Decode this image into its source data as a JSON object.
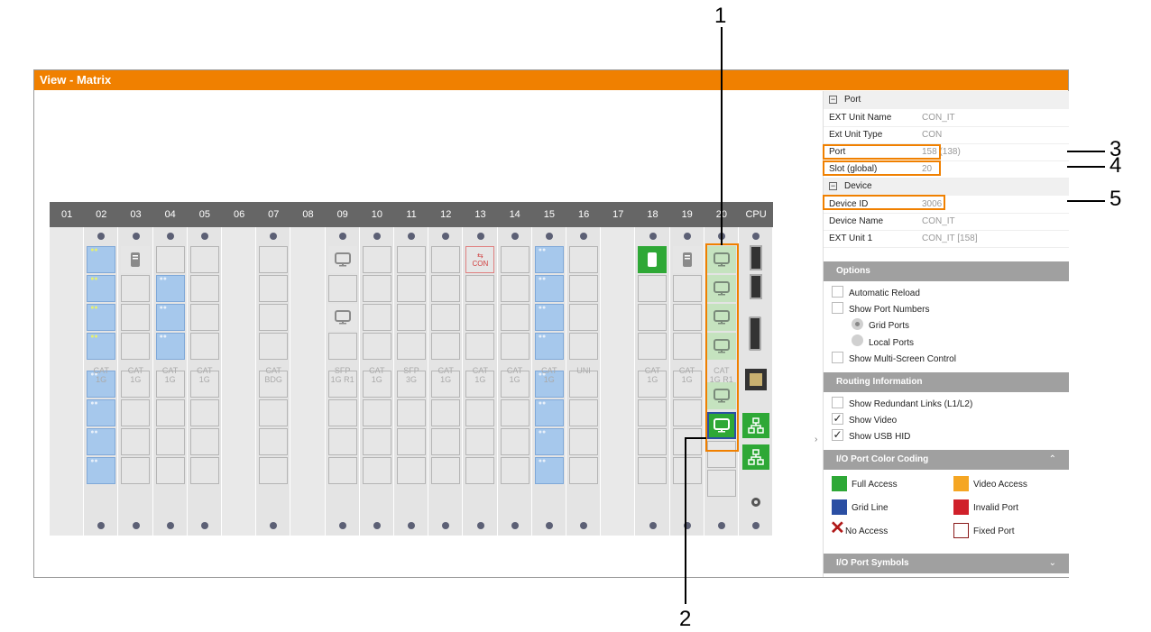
{
  "window": {
    "title": "View - Matrix"
  },
  "matrix": {
    "columns": [
      "01",
      "02",
      "03",
      "04",
      "05",
      "06",
      "07",
      "08",
      "09",
      "10",
      "11",
      "12",
      "13",
      "14",
      "15",
      "16",
      "17",
      "18",
      "19",
      "20",
      "CPU"
    ],
    "card_labels": [
      {
        "col": "02",
        "l1": "CAT",
        "l2": "1G"
      },
      {
        "col": "03",
        "l1": "CAT",
        "l2": "1G"
      },
      {
        "col": "04",
        "l1": "CAT",
        "l2": "1G"
      },
      {
        "col": "05",
        "l1": "CAT",
        "l2": "1G"
      },
      {
        "col": "07",
        "l1": "CAT",
        "l2": "BDG"
      },
      {
        "col": "09",
        "l1": "SFP",
        "l2": "1G R1"
      },
      {
        "col": "10",
        "l1": "CAT",
        "l2": "1G"
      },
      {
        "col": "11",
        "l1": "SFP",
        "l2": "3G"
      },
      {
        "col": "12",
        "l1": "CAT",
        "l2": "1G"
      },
      {
        "col": "13",
        "l1": "CAT",
        "l2": "1G"
      },
      {
        "col": "14",
        "l1": "CAT",
        "l2": "1G"
      },
      {
        "col": "15",
        "l1": "CAT",
        "l2": "1G"
      },
      {
        "col": "16",
        "l1": "UNI",
        "l2": ""
      },
      {
        "col": "18",
        "l1": "CAT",
        "l2": "1G"
      },
      {
        "col": "19",
        "l1": "CAT",
        "l2": "1G"
      },
      {
        "col": "20",
        "l1": "CAT",
        "l2": "1G R1"
      }
    ],
    "usb_port_label": "CON"
  },
  "panel": {
    "port_section": "Port",
    "device_section": "Device",
    "rows_port": [
      {
        "key": "EXT Unit Name",
        "value": "CON_IT"
      },
      {
        "key": "Ext Unit Type",
        "value": "CON"
      },
      {
        "key": "Port",
        "value": "158 (138)"
      },
      {
        "key": "Slot (global)",
        "value": "20"
      }
    ],
    "rows_device": [
      {
        "key": "Device ID",
        "value": "3006"
      },
      {
        "key": "Device Name",
        "value": "CON_IT"
      },
      {
        "key": "EXT Unit 1",
        "value": "CON_IT [158]"
      }
    ],
    "options": {
      "title": "Options",
      "automatic_reload": "Automatic Reload",
      "show_port_numbers": "Show Port Numbers",
      "grid_ports": "Grid Ports",
      "local_ports": "Local Ports",
      "multi_screen": "Show Multi-Screen Control"
    },
    "routing": {
      "title": "Routing Information",
      "redundant": "Show Redundant Links (L1/L2)",
      "video": "Show Video",
      "usb": "Show USB HID",
      "check": "✓"
    },
    "color_coding": {
      "title": "I/O Port Color Coding",
      "full_access": "Full Access",
      "video_access": "Video Access",
      "grid_line": "Grid Line",
      "invalid_port": "Invalid Port",
      "no_access": "No Access",
      "fixed_port": "Fixed Port",
      "colors": {
        "full": "#2ea836",
        "video": "#f5a623",
        "grid": "#2b4fa3",
        "invalid": "#d0202a",
        "noaccess": "#b01818",
        "fixed": "#8a1a1a"
      }
    },
    "symbols": {
      "title": "I/O Port Symbols"
    }
  },
  "callouts": [
    "1",
    "2",
    "3",
    "4",
    "5"
  ]
}
